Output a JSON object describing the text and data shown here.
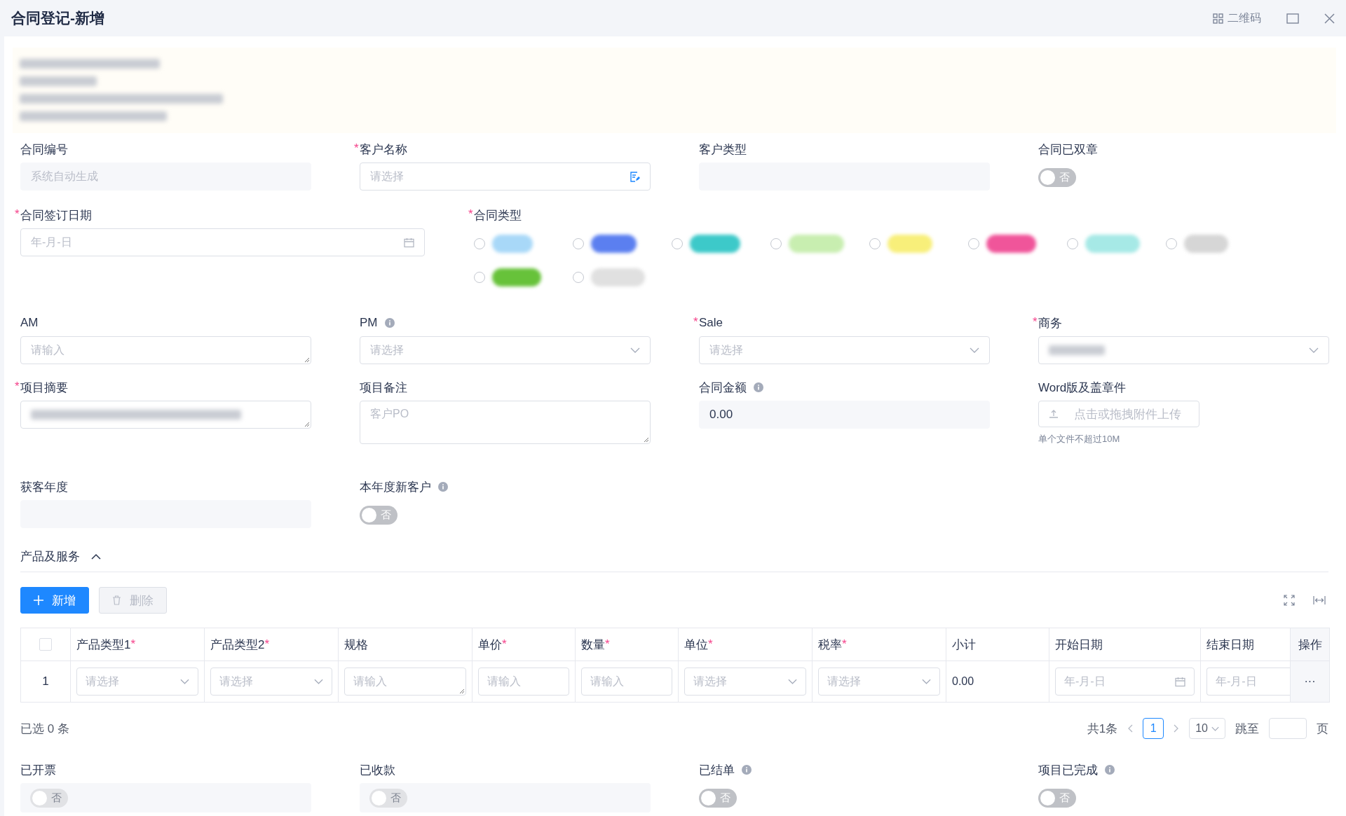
{
  "header": {
    "title": "合同登记-新增",
    "qr_label": "二维码"
  },
  "notice": {
    "redacted": true
  },
  "form_rows": [
    {
      "fields": [
        {
          "label": "合同编号",
          "kind": "readonly",
          "placeholder": "系统自动生成"
        },
        {
          "label": "客户名称",
          "required_mark": "*",
          "kind": "picker",
          "placeholder": "请选择"
        },
        {
          "label": "客户类型",
          "kind": "readonly"
        },
        {
          "label": "合同已双章",
          "kind": "switch",
          "on": false,
          "text": "否",
          "disabled": false
        }
      ]
    },
    {
      "fields": [
        {
          "label": "合同签订日期",
          "required_mark": "*",
          "kind": "date",
          "placeholder": "年-月-日"
        },
        {
          "label": "合同类型",
          "required_mark": "*",
          "kind": "tags",
          "options": [
            {
              "color": "#a8d8f8",
              "selected": false
            },
            {
              "color": "#5b7ff0",
              "selected": false
            },
            {
              "color": "#3dc9c9",
              "selected": false
            },
            {
              "color": "#c8eeb0",
              "selected": false
            },
            {
              "color": "#f8ef7a",
              "selected": false
            },
            {
              "color": "#f0559a",
              "selected": false
            },
            {
              "color": "#a6e9e6",
              "selected": false
            },
            {
              "color": "#d6d6d6",
              "selected": false
            },
            {
              "color": "#67c23a",
              "selected": false
            },
            {
              "color": "#e0e0e0",
              "selected": false
            }
          ]
        }
      ]
    },
    {
      "fields": [
        {
          "label": "AM",
          "kind": "textarea",
          "placeholder": "请输入"
        },
        {
          "label": "PM",
          "info": true,
          "kind": "select",
          "placeholder": "请选择"
        },
        {
          "label": "Sale",
          "required_mark": "*",
          "kind": "select",
          "placeholder": "请选择"
        },
        {
          "label": "商务",
          "required_mark": "*",
          "kind": "select",
          "value_redacted": true
        }
      ]
    },
    {
      "fields": [
        {
          "label": "项目摘要",
          "required_mark": "*",
          "kind": "textarea",
          "value_redacted": true
        },
        {
          "label": "项目备注",
          "kind": "textarea-tall",
          "placeholder": "客户PO"
        },
        {
          "label": "合同金额",
          "info": true,
          "kind": "readonly",
          "value": "0.00"
        },
        {
          "label": "Word版及盖章件",
          "kind": "upload",
          "button": "点击或拖拽附件上传",
          "hint": "单个文件不超过10M"
        }
      ]
    },
    {
      "fields": [
        {
          "label": "获客年度",
          "kind": "readonly"
        },
        {
          "label": "本年度新客户",
          "info": true,
          "kind": "switch",
          "on": false,
          "text": "否",
          "disabled": false
        }
      ]
    }
  ],
  "section": {
    "title": "产品及服务",
    "expanded": true
  },
  "toolbar": {
    "add": "新增",
    "delete": "删除",
    "delete_disabled": true
  },
  "table": {
    "select_all_checked": false,
    "columns": [
      {
        "label": "产品类型1",
        "required_mark": "*"
      },
      {
        "label": "产品类型2",
        "required_mark": "*"
      },
      {
        "label": "规格"
      },
      {
        "label": "单价",
        "required_mark": "*"
      },
      {
        "label": "数量",
        "required_mark": "*"
      },
      {
        "label": "单位",
        "required_mark": "*"
      },
      {
        "label": "税率",
        "required_mark": "*"
      },
      {
        "label": "小计"
      },
      {
        "label": "开始日期"
      },
      {
        "label": "结束日期"
      },
      {
        "label": "操作"
      }
    ],
    "rows": [
      {
        "index": "1",
        "cells": [
          {
            "kind": "select",
            "placeholder": "请选择"
          },
          {
            "kind": "select",
            "placeholder": "请选择"
          },
          {
            "kind": "textarea",
            "placeholder": "请输入"
          },
          {
            "kind": "input",
            "placeholder": "请输入"
          },
          {
            "kind": "input",
            "placeholder": "请输入"
          },
          {
            "kind": "select",
            "placeholder": "请选择"
          },
          {
            "kind": "select",
            "placeholder": "请选择"
          },
          {
            "kind": "text",
            "value": "0.00"
          },
          {
            "kind": "date",
            "placeholder": "年-月-日"
          },
          {
            "kind": "date-cut",
            "placeholder": "年-月-日"
          },
          {
            "kind": "more",
            "value": "···"
          }
        ]
      }
    ]
  },
  "selection_summary": "已选 0 条",
  "pagination": {
    "total": "共1条",
    "pages": [
      {
        "label": "1",
        "selected": true
      }
    ],
    "page_size": "10",
    "jump_label": "跳至",
    "page_suffix": "页"
  },
  "status_fields": [
    {
      "label": "已开票",
      "kind": "switch",
      "on": false,
      "text": "否",
      "disabled": true
    },
    {
      "label": "已收款",
      "kind": "switch",
      "on": false,
      "text": "否",
      "disabled": true
    },
    {
      "label": "已结单",
      "info": true,
      "kind": "switch",
      "on": false,
      "text": "否",
      "disabled": false
    },
    {
      "label": "项目已完成",
      "info": true,
      "kind": "switch",
      "on": false,
      "text": "否",
      "disabled": false
    }
  ]
}
